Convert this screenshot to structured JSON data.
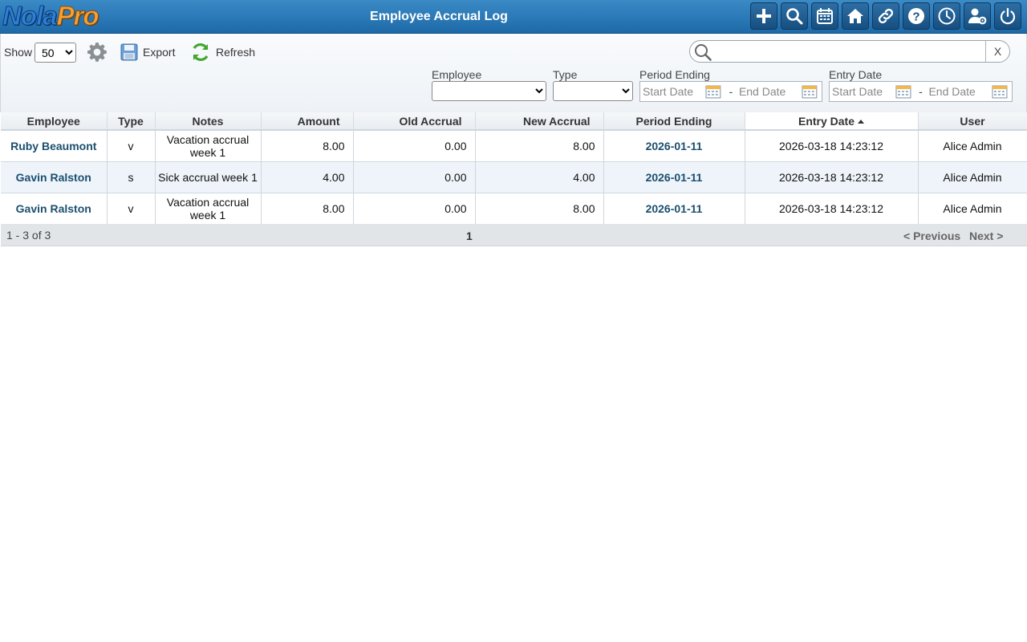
{
  "header": {
    "logo_part1": "Nola",
    "logo_part2": "Pro",
    "title": "Employee Accrual Log",
    "buttons": [
      {
        "icon": "plus-icon"
      },
      {
        "icon": "search-icon"
      },
      {
        "icon": "calendar-icon"
      },
      {
        "icon": "home-icon"
      },
      {
        "icon": "link-icon"
      },
      {
        "icon": "help-icon"
      },
      {
        "icon": "clock-icon"
      },
      {
        "icon": "user-settings-icon"
      },
      {
        "icon": "power-icon"
      }
    ]
  },
  "toolbar": {
    "show_label": "Show",
    "show_value": "50",
    "show_options": [
      "50"
    ],
    "export_label": "Export",
    "refresh_label": "Refresh",
    "search_placeholder": "",
    "search_clear": "X"
  },
  "filters": {
    "employee_label": "Employee",
    "type_label": "Type",
    "period_label": "Period Ending",
    "entry_label": "Entry Date",
    "start_placeholder": "Start Date",
    "end_placeholder": "End Date",
    "dash": "-"
  },
  "table": {
    "columns": [
      "Employee",
      "Type",
      "Notes",
      "Amount",
      "Old Accrual",
      "New Accrual",
      "Period Ending",
      "Entry Date",
      "User"
    ],
    "rows": [
      {
        "employee": "Ruby Beaumont",
        "type": "v",
        "notes": "Vacation accrual week 1",
        "amount": "8.00",
        "old": "0.00",
        "new": "8.00",
        "period": "2026-01-11",
        "entry": "2026-03-18 14:23:12",
        "user": "Alice Admin"
      },
      {
        "employee": "Gavin Ralston",
        "type": "s",
        "notes": "Sick accrual week 1",
        "amount": "4.00",
        "old": "0.00",
        "new": "4.00",
        "period": "2026-01-11",
        "entry": "2026-03-18 14:23:12",
        "user": "Alice Admin"
      },
      {
        "employee": "Gavin Ralston",
        "type": "v",
        "notes": "Vacation accrual week 1",
        "amount": "8.00",
        "old": "0.00",
        "new": "8.00",
        "period": "2026-01-11",
        "entry": "2026-03-18 14:23:12",
        "user": "Alice Admin"
      }
    ]
  },
  "footer": {
    "count": "1 - 3 of 3",
    "page": "1",
    "prev": "< Previous",
    "next": "Next >"
  }
}
